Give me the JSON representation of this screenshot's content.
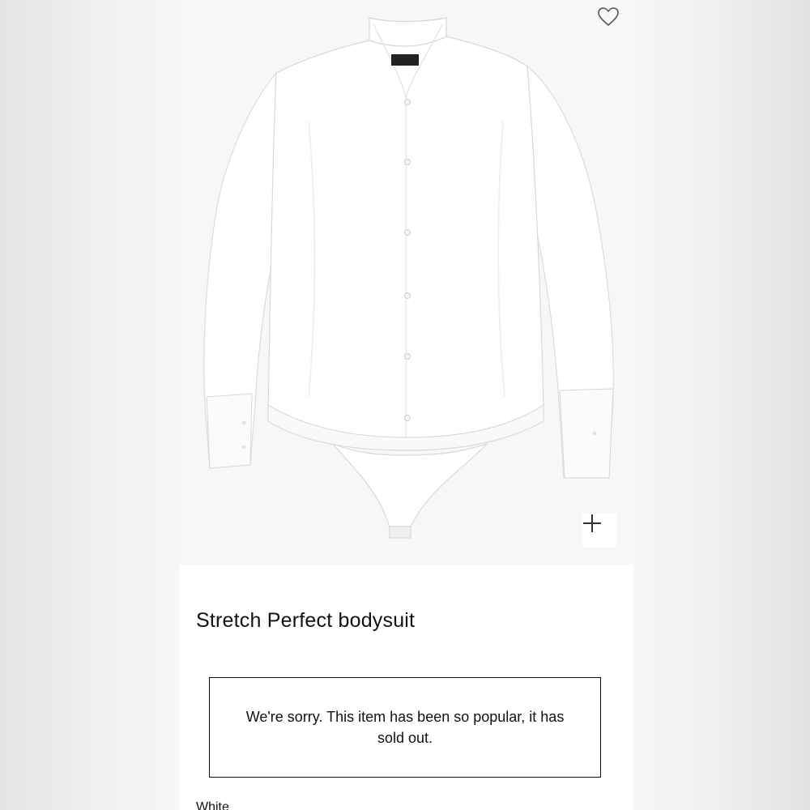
{
  "product": {
    "image_alt": "Stretch Perfect bodysuit",
    "title": "Stretch Perfect bodysuit",
    "sold_out_message": "We're sorry. This item has been so popular, it has sold out.",
    "color_label": "White"
  },
  "icons": {
    "wishlist": "heart-icon",
    "zoom": "plus-icon"
  },
  "colors": {
    "background": "#ececec",
    "card": "#ffffff",
    "text": "#111111",
    "image_background": "#f7f7f7"
  }
}
